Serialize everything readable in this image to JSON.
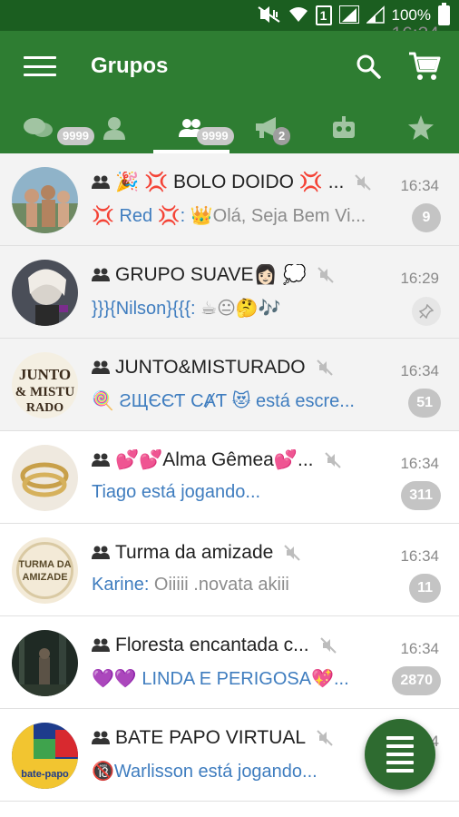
{
  "status_bar": {
    "battery_pct": "100%",
    "time": "16:34",
    "sim_label": "1"
  },
  "app_bar": {
    "title": "Grupos",
    "menu_icon": "hamburger-menu-icon",
    "search_icon": "search-icon",
    "cart_icon": "shopping-cart-icon"
  },
  "tabs": [
    {
      "icon": "chat-bubbles-icon",
      "badge": "9999"
    },
    {
      "icon": "person-icon",
      "badge": ""
    },
    {
      "icon": "group-icon",
      "badge": "9999",
      "active": true
    },
    {
      "icon": "megaphone-icon",
      "badge": "2"
    },
    {
      "icon": "robot-icon",
      "badge": ""
    },
    {
      "icon": "star-icon",
      "badge": ""
    }
  ],
  "chats": [
    {
      "name": "🎉 💢 BOLO DOIDO 💢 ...",
      "time": "16:34",
      "sender": "💢 Red 💢:",
      "message": " 👑Olá, Seja Bem Vi...",
      "badge": "9"
    },
    {
      "name": "GRUPO SUAVE👩🏻 💭",
      "time": "16:29",
      "sender": "}}}{Nilson}{{{:",
      "message": " ☕😐🤔🎶",
      "badge": ""
    },
    {
      "name": "JUNTO&MISTURADO",
      "time": "16:34",
      "sender": "",
      "message": "🍭 ƧЩЄЄƬ CȺƬ 😻 está escre...",
      "badge": "51"
    },
    {
      "name": "💕💕Alma Gêmea💕...",
      "time": "16:34",
      "sender": "",
      "message": "Tiago está jogando...",
      "badge": "311"
    },
    {
      "name": "Turma da amizade",
      "time": "16:34",
      "sender": "Karine:",
      "message": " Oiiiii .novata akiii",
      "badge": "11"
    },
    {
      "name": "Floresta encantada c...",
      "time": "16:34",
      "sender": "",
      "message": "💜💜 LINDA E PERIGOSA💖...",
      "badge": "2870"
    },
    {
      "name": "BATE PAPO VIRTUAL",
      "time": "16:34",
      "sender": "",
      "message": "🔞Warlisson está jogando...",
      "badge": ""
    }
  ],
  "avatar_texts": {
    "junto": "JUNTO & MISTURADO",
    "turma": "TURMA DA AMIZADE",
    "bate": "bate-papo"
  },
  "colors": {
    "status_bar": "#1b5e20",
    "app_bar": "#2e7d32",
    "link_blue": "#3f7dbf",
    "badge_grey": "#c4c4c4"
  },
  "fab_icon": "list-icon"
}
